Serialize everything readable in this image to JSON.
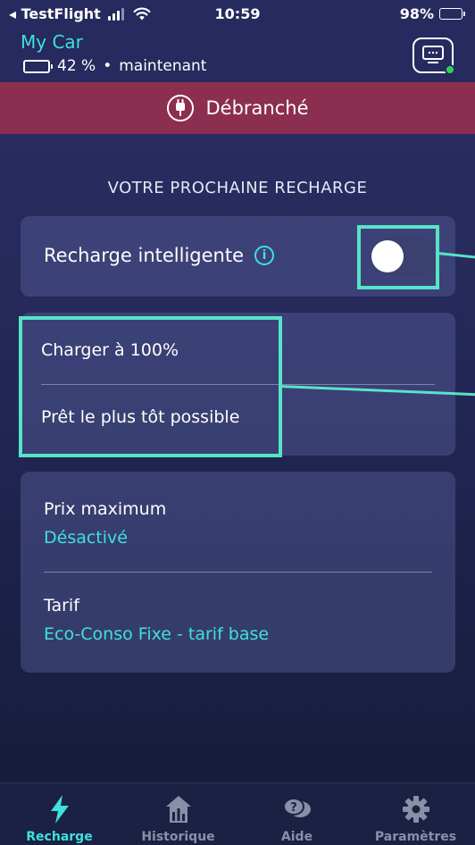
{
  "status_bar": {
    "carrier": "◂ TestFlight",
    "time": "10:59",
    "battery": "98%"
  },
  "header": {
    "car_name": "My Car",
    "battery_percent": "42 %",
    "separator": "•",
    "updated": "maintenant"
  },
  "banner": {
    "label": "Débranché"
  },
  "section_title": "VOTRE PROCHAINE RECHARGE",
  "smart_charging": {
    "label": "Recharge intelligente",
    "enabled": false
  },
  "charge_options": {
    "target": "Charger à 100%",
    "ready": "Prêt le plus tôt possible"
  },
  "pricing": {
    "max_price_label": "Prix maximum",
    "max_price_value": "Désactivé",
    "tariff_label": "Tarif",
    "tariff_value": "Eco-Conso Fixe - tarif base"
  },
  "tabs": [
    {
      "label": "Recharge",
      "icon": "bolt-icon",
      "active": true
    },
    {
      "label": "Historique",
      "icon": "history-icon",
      "active": false
    },
    {
      "label": "Aide",
      "icon": "help-icon",
      "active": false
    },
    {
      "label": "Paramètres",
      "icon": "gear-icon",
      "active": false
    }
  ],
  "colors": {
    "accent": "#3fe0dd",
    "banner": "#8c2e4f",
    "highlight": "#57e3c8"
  }
}
